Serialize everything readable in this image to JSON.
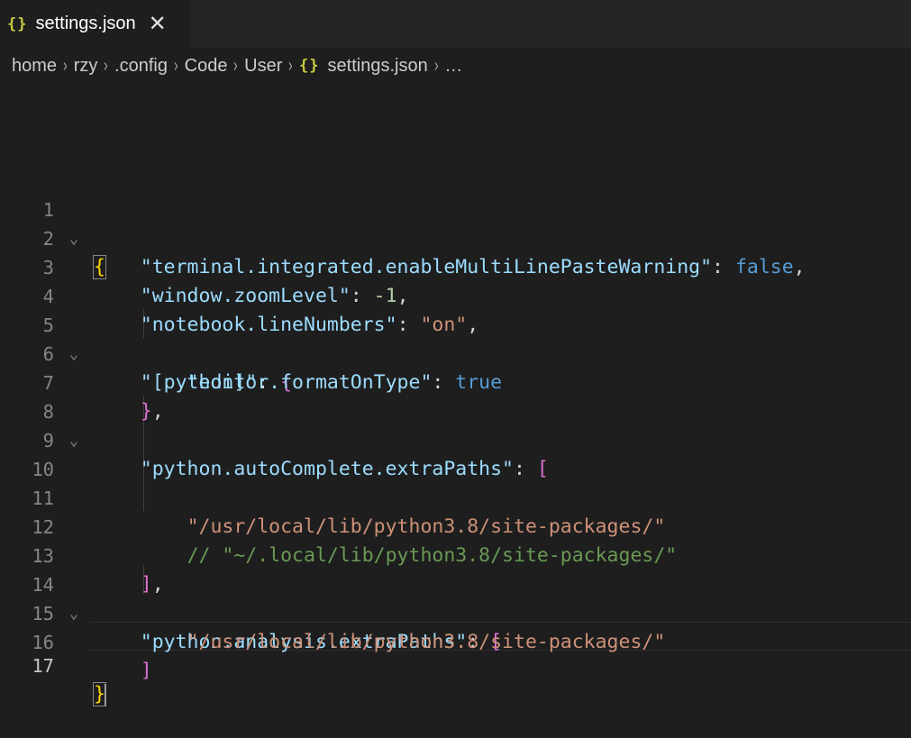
{
  "tab": {
    "icon": "{}",
    "title": "settings.json",
    "close": "✕"
  },
  "breadcrumb": {
    "items": [
      "home",
      "rzy",
      ".config",
      "Code",
      "User"
    ],
    "file_icon": "{}",
    "file": "settings.json",
    "ellipsis": "…",
    "separator": "›"
  },
  "editor": {
    "line_numbers": [
      "1",
      "2",
      "3",
      "4",
      "5",
      "6",
      "7",
      "8",
      "9",
      "10",
      "11",
      "12",
      "13",
      "14",
      "15",
      "16",
      "17"
    ],
    "lines": {
      "l1_brace": "{",
      "l2_key": "\"terminal.integrated.enableMultiLinePasteWarning\"",
      "l2_colon": ": ",
      "l2_val": "false",
      "l2_comma": ",",
      "l3_key": "\"window.zoomLevel\"",
      "l3_colon": ": ",
      "l3_val": "-1",
      "l3_comma": ",",
      "l4_key": "\"notebook.lineNumbers\"",
      "l4_colon": ": ",
      "l4_val": "\"on\"",
      "l4_comma": ",",
      "l5_key": "\"[python]\"",
      "l5_colon": ": ",
      "l5_brace": "{",
      "l6_key": "\"editor.formatOnType\"",
      "l6_colon": ": ",
      "l6_val": "true",
      "l7_brace": "}",
      "l7_comma": ",",
      "l8_key": "\"python.autoComplete.extraPaths\"",
      "l8_colon": ": ",
      "l8_bracket": "[",
      "l11_val": "\"/usr/local/lib/python3.8/site-packages/\"",
      "l12_comment": "// \"~/.local/lib/python3.8/site-packages/\"",
      "l13_bracket": "]",
      "l13_comma": ",",
      "l14_key": "\"python.analysis.extraPaths\"",
      "l14_colon": ": ",
      "l14_bracket": "[",
      "l15_val": "\"/usr/local/lib/python3.8/site-packages/\"",
      "l16_bracket": "]",
      "l17_brace": "}"
    },
    "fold_icon": "⌄"
  },
  "colors": {
    "background": "#1e1e1e",
    "key": "#9cdcfe",
    "string": "#ce9178",
    "keyword": "#569cd6",
    "comment": "#6a9955",
    "bracket_level1": "#ffd700",
    "bracket_level2": "#da70d6"
  }
}
